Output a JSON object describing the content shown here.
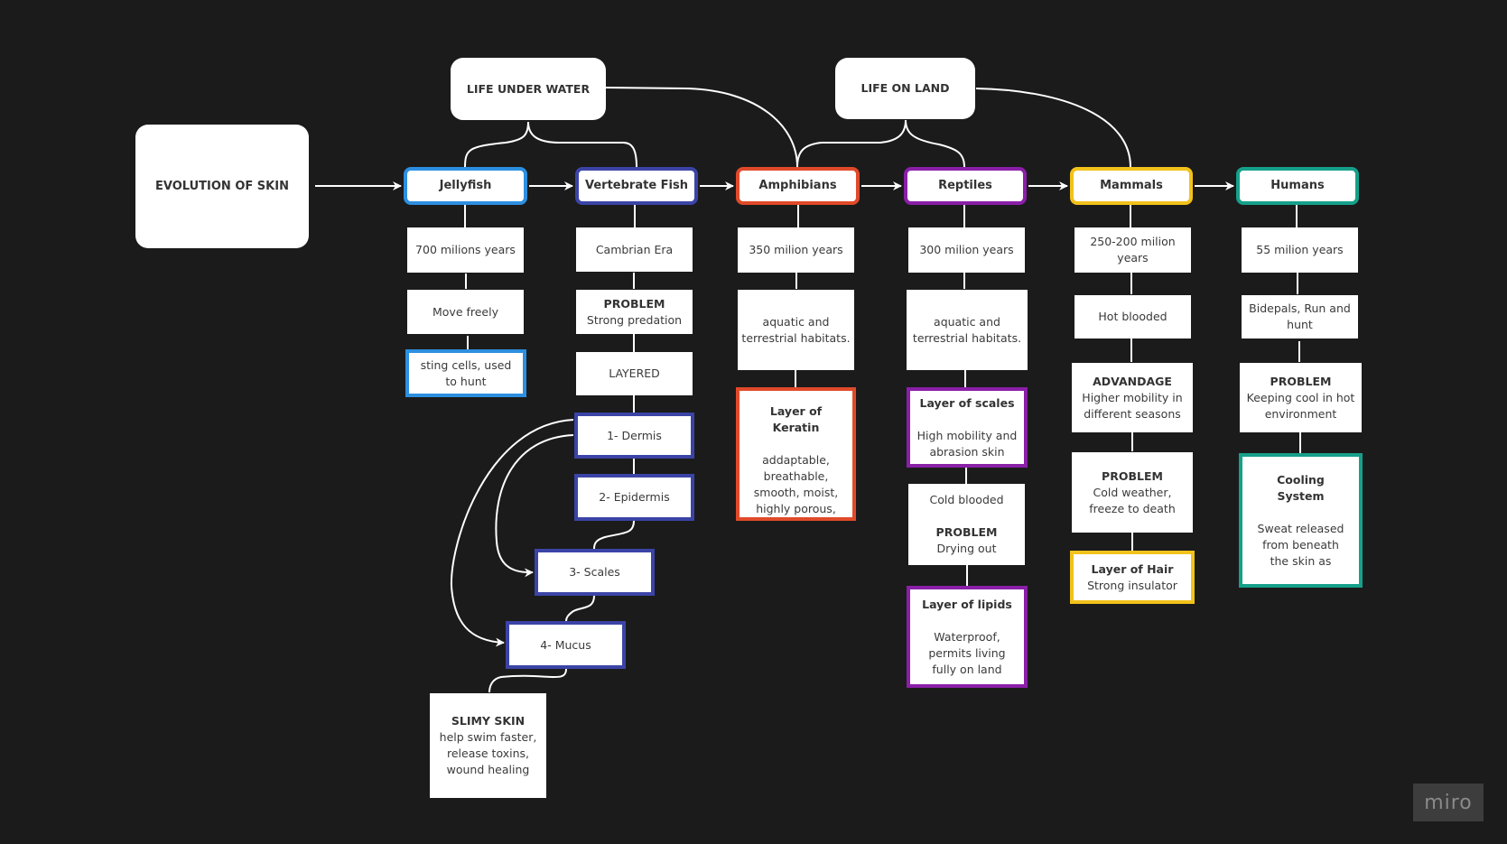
{
  "title": "EVOLUTION OF SKIN",
  "groups": {
    "water": "LIFE UNDER WATER",
    "land": "LIFE ON LAND"
  },
  "stages": [
    {
      "label": "Jellyfish",
      "color": "#2d8fe0"
    },
    {
      "label": "Vertebrate Fish",
      "color": "#3b44a6"
    },
    {
      "label": "Amphibians",
      "color": "#e04a2a"
    },
    {
      "label": "Reptiles",
      "color": "#8a1fa8"
    },
    {
      "label": "Mammals",
      "color": "#f2c21b"
    },
    {
      "label": "Humans",
      "color": "#16a08a"
    }
  ],
  "jellyfish": {
    "age": "700 milions years",
    "trait": "Move freely",
    "skin": "sting cells, used to hunt"
  },
  "fish": {
    "era": "Cambrian Era",
    "problem_title": "PROBLEM",
    "problem_text": "Strong predation",
    "layered": "LAYERED",
    "layers": [
      "1- Dermis",
      "2- Epidermis",
      "3- Scales",
      "4- Mucus"
    ],
    "slimy_title": "SLIMY SKIN",
    "slimy_text": "help swim faster, release toxins, wound healing"
  },
  "amphibians": {
    "age": "350 milion years",
    "habitat": "aquatic and terrestrial habitats.",
    "layer_title": "Layer of Keratin",
    "layer_text": "addaptable, breathable, smooth, moist, highly porous,"
  },
  "reptiles": {
    "age": "300 milion years",
    "habitat": "aquatic and terrestrial habitats.",
    "scales_title": "Layer of scales",
    "scales_text": "High mobility and abrasion skin",
    "blood": "Cold blooded",
    "problem_title": "PROBLEM",
    "problem_text": "Drying out",
    "lipids_title": "Layer of lipids",
    "lipids_text": "Waterproof, permits living fully on land"
  },
  "mammals": {
    "age": "250-200 milion years",
    "blood": "Hot blooded",
    "adv_title": "ADVANDAGE",
    "adv_text": "Higher mobility in different seasons",
    "problem_title": "PROBLEM",
    "problem_text": "Cold weather, freeze to death",
    "hair_title": "Layer of Hair",
    "hair_text": "Strong insulator"
  },
  "humans": {
    "age": "55 milion years",
    "trait": "Bidepals, Run and hunt",
    "problem_title": "PROBLEM",
    "problem_text": "Keeping cool in hot environment",
    "cool_title": "Cooling System",
    "cool_text": "Sweat released from beneath the skin as"
  },
  "watermark": "miro"
}
